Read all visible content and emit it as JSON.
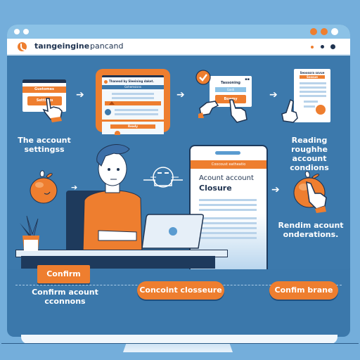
{
  "browser": {
    "brand_bold": "taıngeingine",
    "brand_light": "pancand",
    "window_controls_left": [
      "dot",
      "dot"
    ],
    "window_controls_right": [
      "orange-dot",
      "orange-dot",
      "white-dot"
    ],
    "toolbar_dots": [
      "small-orange-dot",
      "navy-dot",
      "navy-dot"
    ]
  },
  "colors": {
    "background": "#74aedb",
    "panel": "#3c79ac",
    "accent": "#ee7e2f",
    "navy": "#1f3350",
    "white": "#ffffff"
  },
  "steps": [
    {
      "caption_line1": "The account",
      "caption_line2": "settingss",
      "mini_header": "Gustomes",
      "mini_button": "Settings"
    },
    {
      "mini_title": "Thanesd by Sleeining daket.",
      "mini_subtitle": "Gshemsisns",
      "mini_button": "Ready"
    },
    {
      "mini_title": "Tassoning",
      "mini_field": "Gaidi",
      "mini_button": "Boamy"
    },
    {
      "caption_line1": "Reading  roughhe",
      "caption_line2": "account condions",
      "doc_title": "Seoossra ssvue",
      "doc_badge": "Sossue"
    }
  ],
  "closure_card": {
    "header": "Coocoust eatheatio",
    "title_line1": "Acount account",
    "title_line2": "Closure"
  },
  "right_caption": {
    "line1": "Rendim acount",
    "line2": "onderations."
  },
  "bottom": {
    "confirm_button": "Confirm",
    "confirm_caption_line1": "Confirm acount",
    "confirm_caption_line2": "cconnons",
    "pill_center": "Concoint closseure",
    "pill_right": "Confim brane"
  },
  "icons": {
    "logo": "tangerine-logo-icon",
    "check": "check-circle-icon",
    "tangerine": "tangerine-fruit-icon",
    "hand": "pointing-hand-icon",
    "arrow": "arrow-right-icon",
    "face": "face-line-icon",
    "plant": "potted-plant-icon",
    "laptop": "laptop-icon"
  },
  "glyphs": {
    "arrow": "➔"
  }
}
